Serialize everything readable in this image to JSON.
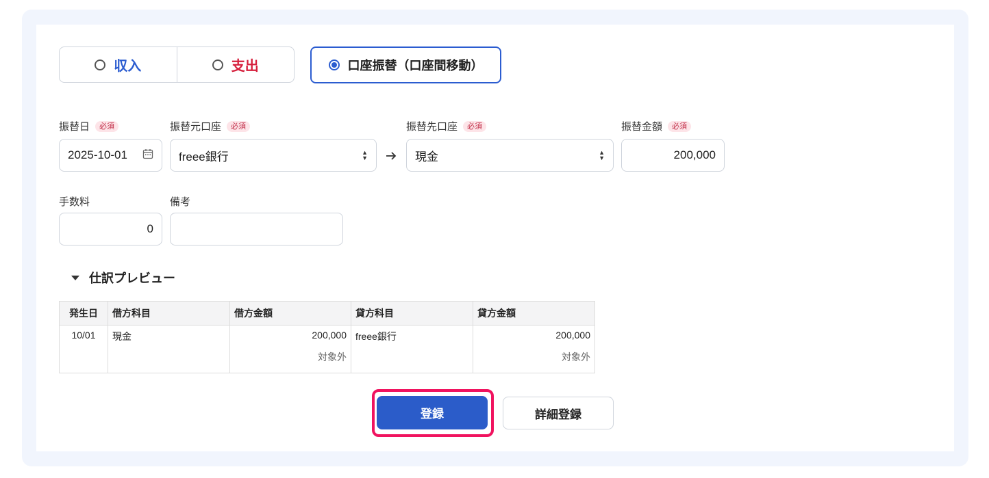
{
  "type_selector": {
    "income": {
      "label": "収入",
      "color": "#2b5cd0"
    },
    "expense": {
      "label": "支出",
      "color": "#d61f3c"
    },
    "transfer": {
      "label": "口座振替（口座間移動）"
    }
  },
  "required_badge": "必須",
  "form": {
    "date": {
      "label": "振替日",
      "value": "2025-10-01"
    },
    "from_account": {
      "label": "振替元口座",
      "value": "freee銀行"
    },
    "to_account": {
      "label": "振替先口座",
      "value": "現金"
    },
    "amount": {
      "label": "振替金額",
      "value": "200,000"
    },
    "fee": {
      "label": "手数料",
      "value": "0"
    },
    "memo": {
      "label": "備考",
      "value": ""
    }
  },
  "preview": {
    "toggle_label": "仕訳プレビュー",
    "headers": [
      "発生日",
      "借方科目",
      "借方金額",
      "貸方科目",
      "貸方金額"
    ],
    "row": {
      "date": "10/01",
      "debit_account": "現金",
      "debit_amount": "200,000",
      "debit_tax": "対象外",
      "credit_account": "freee銀行",
      "credit_amount": "200,000",
      "credit_tax": "対象外"
    }
  },
  "buttons": {
    "register": "登録",
    "detail_register": "詳細登録"
  }
}
